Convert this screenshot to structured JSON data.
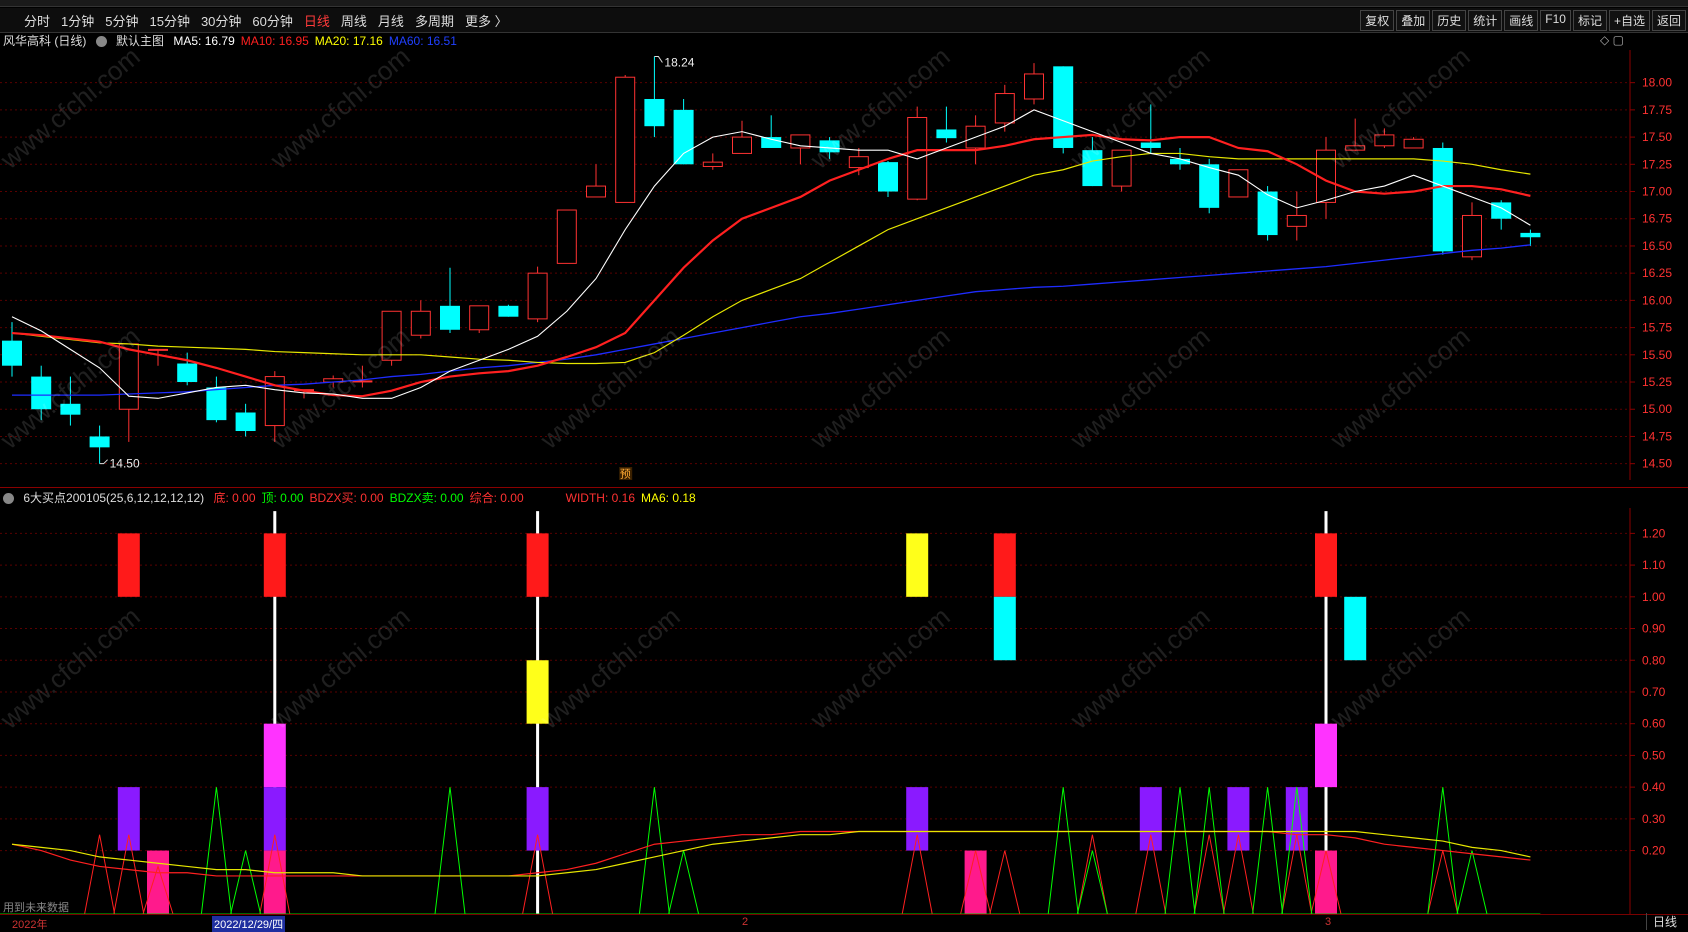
{
  "toolbar": {
    "periods": [
      "分时",
      "1分钟",
      "5分钟",
      "15分钟",
      "30分钟",
      "60分钟",
      "日线",
      "周线",
      "月线",
      "多周期",
      "更多 〉"
    ],
    "active_period": "日线",
    "right_buttons": [
      "复权",
      "叠加",
      "历史",
      "统计",
      "画线",
      "F10",
      "标记",
      "+自选",
      "返回"
    ]
  },
  "main_legend": {
    "stock": "风华高科 (日线)",
    "template": "默认主图",
    "items": [
      {
        "label": "MA5: 16.79",
        "color": "#ffffff"
      },
      {
        "label": "MA10: 16.95",
        "color": "#ff2020"
      },
      {
        "label": "MA20: 17.16",
        "color": "#ffff00"
      },
      {
        "label": "MA60: 16.51",
        "color": "#2040ff"
      }
    ]
  },
  "main_chart": {
    "type": "candlestick",
    "y_ticks": [
      "18.00",
      "17.75",
      "17.50",
      "17.25",
      "17.00",
      "16.75",
      "16.50",
      "16.25",
      "16.00",
      "15.75",
      "15.50",
      "15.25",
      "15.00",
      "14.75",
      "14.50"
    ],
    "ylim": [
      14.35,
      18.3
    ],
    "high_label": "18.24",
    "low_label": "14.50",
    "marker": "预",
    "colors": {
      "up": "#ff3232",
      "down": "#00ffff",
      "ma5": "#ffffff",
      "ma10": "#ff2020",
      "ma20": "#e6e600",
      "ma60": "#1e2cff"
    },
    "candles": [
      [
        15.63,
        15.4,
        15.8,
        15.3
      ],
      [
        15.3,
        15.0,
        15.4,
        14.9
      ],
      [
        15.05,
        14.95,
        15.3,
        14.85
      ],
      [
        14.75,
        14.65,
        14.85,
        14.5
      ],
      [
        15.0,
        15.6,
        15.6,
        14.7
      ],
      [
        15.55,
        15.55,
        15.55,
        15.4
      ],
      [
        15.42,
        15.25,
        15.52,
        15.22
      ],
      [
        15.2,
        14.9,
        15.3,
        14.88
      ],
      [
        14.97,
        14.8,
        15.05,
        14.75
      ],
      [
        14.85,
        15.3,
        15.35,
        14.7
      ],
      [
        15.18,
        15.18,
        15.18,
        15.1
      ],
      [
        15.25,
        15.28,
        15.31,
        15.2
      ],
      [
        15.26,
        15.26,
        15.4,
        15.2
      ],
      [
        15.45,
        15.9,
        15.9,
        15.4
      ],
      [
        15.68,
        15.9,
        16.0,
        15.65
      ],
      [
        15.95,
        15.73,
        16.3,
        15.7
      ],
      [
        15.73,
        15.95,
        15.95,
        15.7
      ],
      [
        15.95,
        15.85,
        15.96,
        15.85
      ],
      [
        15.83,
        16.25,
        16.31,
        15.8
      ],
      [
        16.34,
        16.83,
        16.83,
        16.34
      ],
      [
        16.95,
        17.05,
        17.25,
        16.95
      ],
      [
        16.9,
        18.05,
        18.07,
        16.9
      ],
      [
        17.85,
        17.6,
        18.24,
        17.5
      ],
      [
        17.75,
        17.25,
        17.85,
        17.25
      ],
      [
        17.23,
        17.27,
        17.35,
        17.2
      ],
      [
        17.35,
        17.5,
        17.65,
        17.35
      ],
      [
        17.5,
        17.4,
        17.7,
        17.4
      ],
      [
        17.4,
        17.52,
        17.52,
        17.25
      ],
      [
        17.47,
        17.36,
        17.5,
        17.3
      ],
      [
        17.22,
        17.32,
        17.4,
        17.15
      ],
      [
        17.27,
        17.0,
        17.28,
        16.95
      ],
      [
        16.93,
        17.68,
        17.78,
        16.92
      ],
      [
        17.57,
        17.49,
        17.78,
        17.45
      ],
      [
        17.4,
        17.6,
        17.7,
        17.25
      ],
      [
        17.63,
        17.9,
        17.98,
        17.55
      ],
      [
        17.85,
        18.08,
        18.18,
        17.8
      ],
      [
        18.15,
        17.4,
        18.15,
        17.35
      ],
      [
        17.38,
        17.05,
        17.5,
        17.05
      ],
      [
        17.05,
        17.38,
        17.38,
        17.0
      ],
      [
        17.45,
        17.4,
        17.8,
        17.35
      ],
      [
        17.3,
        17.25,
        17.4,
        17.2
      ],
      [
        17.25,
        16.85,
        17.3,
        16.8
      ],
      [
        16.95,
        17.2,
        17.2,
        16.95
      ],
      [
        17.0,
        16.6,
        17.05,
        16.55
      ],
      [
        16.68,
        16.78,
        17.0,
        16.55
      ],
      [
        16.9,
        17.38,
        17.5,
        16.75
      ],
      [
        17.38,
        17.42,
        17.67,
        17.37
      ],
      [
        17.42,
        17.52,
        17.58,
        17.4
      ],
      [
        17.4,
        17.48,
        17.5,
        17.4
      ],
      [
        17.4,
        16.45,
        17.45,
        16.42
      ],
      [
        16.4,
        16.78,
        16.9,
        16.37
      ],
      [
        16.9,
        16.75,
        16.92,
        16.65
      ],
      [
        16.62,
        16.58,
        16.65,
        16.5
      ]
    ],
    "ma5": [
      15.85,
      15.72,
      15.55,
      15.38,
      15.12,
      15.1,
      15.15,
      15.2,
      15.22,
      15.18,
      15.15,
      15.14,
      15.1,
      15.1,
      15.2,
      15.35,
      15.45,
      15.55,
      15.67,
      15.9,
      16.2,
      16.65,
      17.05,
      17.35,
      17.5,
      17.55,
      17.48,
      17.42,
      17.4,
      17.38,
      17.38,
      17.3,
      17.4,
      17.5,
      17.6,
      17.75,
      17.65,
      17.55,
      17.45,
      17.35,
      17.3,
      17.22,
      17.15,
      16.97,
      16.85,
      16.92,
      17.0,
      17.05,
      17.15,
      17.05,
      16.95,
      16.85,
      16.69
    ],
    "ma10": [
      15.7,
      15.68,
      15.65,
      15.62,
      15.55,
      15.5,
      15.45,
      15.38,
      15.3,
      15.22,
      15.17,
      15.13,
      15.12,
      15.17,
      15.25,
      15.3,
      15.33,
      15.35,
      15.4,
      15.48,
      15.57,
      15.7,
      16.0,
      16.3,
      16.55,
      16.75,
      16.85,
      16.95,
      17.1,
      17.2,
      17.3,
      17.38,
      17.38,
      17.38,
      17.42,
      17.48,
      17.5,
      17.52,
      17.48,
      17.47,
      17.5,
      17.5,
      17.4,
      17.37,
      17.25,
      17.1,
      17.0,
      16.98,
      17.0,
      17.05,
      17.05,
      17.02,
      16.96
    ],
    "ma20": [
      15.7,
      15.67,
      15.64,
      15.61,
      15.6,
      15.58,
      15.57,
      15.56,
      15.55,
      15.53,
      15.52,
      15.51,
      15.5,
      15.5,
      15.5,
      15.48,
      15.46,
      15.45,
      15.43,
      15.42,
      15.42,
      15.43,
      15.52,
      15.68,
      15.85,
      16.0,
      16.1,
      16.2,
      16.35,
      16.5,
      16.65,
      16.75,
      16.85,
      16.95,
      17.05,
      17.15,
      17.2,
      17.28,
      17.32,
      17.35,
      17.35,
      17.32,
      17.3,
      17.3,
      17.3,
      17.3,
      17.3,
      17.3,
      17.3,
      17.28,
      17.25,
      17.2,
      17.16
    ],
    "ma60": [
      15.13,
      15.13,
      15.13,
      15.13,
      15.14,
      15.15,
      15.16,
      15.18,
      15.2,
      15.22,
      15.23,
      15.25,
      15.27,
      15.3,
      15.32,
      15.35,
      15.38,
      15.4,
      15.43,
      15.46,
      15.5,
      15.55,
      15.6,
      15.65,
      15.7,
      15.75,
      15.8,
      15.85,
      15.88,
      15.92,
      15.96,
      16.0,
      16.04,
      16.08,
      16.1,
      16.12,
      16.13,
      16.15,
      16.17,
      16.19,
      16.21,
      16.23,
      16.25,
      16.27,
      16.29,
      16.31,
      16.34,
      16.37,
      16.4,
      16.43,
      16.46,
      16.48,
      16.51
    ]
  },
  "sub_legend": {
    "name": "6大买点200105(25,6,12,12,12,12)",
    "items": [
      {
        "label": "底: 0.00",
        "color": "#ff3232"
      },
      {
        "label": "顶: 0.00",
        "color": "#00ff00"
      },
      {
        "label": "BDZX买: 0.00",
        "color": "#ff3232"
      },
      {
        "label": "BDZX卖: 0.00",
        "color": "#00ff00"
      },
      {
        "label": "综合: 0.00",
        "color": "#ff3232"
      },
      {
        "label": "WIDTH: 0.16",
        "color": "#ff3232"
      },
      {
        "label": "MA6: 0.18",
        "color": "#ffff00"
      }
    ]
  },
  "sub_chart": {
    "y_ticks": [
      "1.20",
      "1.10",
      "1.00",
      "0.90",
      "0.80",
      "0.70",
      "0.60",
      "0.50",
      "0.40",
      "0.30",
      "0.20"
    ],
    "ylim": [
      0.0,
      1.28
    ],
    "bars": [
      {
        "i": 4,
        "bottom": 1.0,
        "top": 1.2,
        "color": "#ff1a1a"
      },
      {
        "i": 4,
        "bottom": 0.2,
        "top": 0.4,
        "color": "#8a1aff"
      },
      {
        "i": 5,
        "bottom": 0.0,
        "top": 0.2,
        "color": "#ff1a8c"
      },
      {
        "i": 9,
        "bottom": 1.0,
        "top": 1.2,
        "color": "#ff1a1a"
      },
      {
        "i": 9,
        "bottom": 0.4,
        "top": 0.6,
        "color": "#ff33ff"
      },
      {
        "i": 9,
        "bottom": 0.2,
        "top": 0.4,
        "color": "#8a1aff"
      },
      {
        "i": 9,
        "bottom": 0.0,
        "top": 0.2,
        "color": "#ff1a8c"
      },
      {
        "i": 18,
        "bottom": 1.0,
        "top": 1.2,
        "color": "#ff1a1a"
      },
      {
        "i": 18,
        "bottom": 0.6,
        "top": 0.8,
        "color": "#ffff1a"
      },
      {
        "i": 18,
        "bottom": 0.2,
        "top": 0.4,
        "color": "#8a1aff"
      },
      {
        "i": 31,
        "bottom": 1.0,
        "top": 1.2,
        "color": "#ffff1a"
      },
      {
        "i": 31,
        "bottom": 0.2,
        "top": 0.4,
        "color": "#8a1aff"
      },
      {
        "i": 33,
        "bottom": 0.0,
        "top": 0.2,
        "color": "#ff1a8c"
      },
      {
        "i": 34,
        "bottom": 1.0,
        "top": 1.2,
        "color": "#ff1a1a"
      },
      {
        "i": 34,
        "bottom": 0.8,
        "top": 1.0,
        "color": "#00ffff"
      },
      {
        "i": 39,
        "bottom": 0.2,
        "top": 0.4,
        "color": "#8a1aff"
      },
      {
        "i": 42,
        "bottom": 0.2,
        "top": 0.4,
        "color": "#8a1aff"
      },
      {
        "i": 44,
        "bottom": 0.2,
        "top": 0.4,
        "color": "#8a1aff"
      },
      {
        "i": 45,
        "bottom": 1.0,
        "top": 1.2,
        "color": "#ff1a1a"
      },
      {
        "i": 45,
        "bottom": 0.4,
        "top": 0.6,
        "color": "#ff33ff"
      },
      {
        "i": 45,
        "bottom": 0.0,
        "top": 0.2,
        "color": "#ff1a8c"
      },
      {
        "i": 46,
        "bottom": 0.8,
        "top": 1.0,
        "color": "#00ffff"
      }
    ],
    "white_lines": [
      9,
      18,
      45
    ],
    "red_spikes": [
      [
        3,
        0.25
      ],
      [
        4,
        0.25
      ],
      [
        5,
        0.15
      ],
      [
        9,
        0.25
      ],
      [
        18,
        0.25
      ],
      [
        31,
        0.25
      ],
      [
        33,
        0.2
      ],
      [
        34,
        0.2
      ],
      [
        37,
        0.25
      ],
      [
        39,
        0.25
      ],
      [
        41,
        0.25
      ],
      [
        42,
        0.25
      ],
      [
        44,
        0.25
      ],
      [
        45,
        0.2
      ],
      [
        49,
        0.2
      ]
    ],
    "green_spikes": [
      [
        7,
        0.4
      ],
      [
        8,
        0.2
      ],
      [
        15,
        0.4
      ],
      [
        22,
        0.4
      ],
      [
        23,
        0.2
      ],
      [
        36,
        0.4
      ],
      [
        37,
        0.2
      ],
      [
        40,
        0.4
      ],
      [
        41,
        0.4
      ],
      [
        43,
        0.4
      ],
      [
        44,
        0.4
      ],
      [
        49,
        0.4
      ],
      [
        50,
        0.2
      ]
    ],
    "width_line": [
      0.22,
      0.2,
      0.17,
      0.15,
      0.14,
      0.13,
      0.13,
      0.12,
      0.12,
      0.12,
      0.12,
      0.12,
      0.12,
      0.12,
      0.12,
      0.12,
      0.12,
      0.12,
      0.13,
      0.14,
      0.16,
      0.19,
      0.22,
      0.23,
      0.24,
      0.25,
      0.25,
      0.26,
      0.26,
      0.26,
      0.26,
      0.26,
      0.26,
      0.26,
      0.26,
      0.26,
      0.26,
      0.26,
      0.26,
      0.26,
      0.26,
      0.26,
      0.26,
      0.26,
      0.25,
      0.25,
      0.24,
      0.22,
      0.21,
      0.2,
      0.19,
      0.18,
      0.17
    ],
    "ma6_line": [
      0.22,
      0.21,
      0.2,
      0.18,
      0.17,
      0.16,
      0.15,
      0.14,
      0.14,
      0.13,
      0.13,
      0.13,
      0.12,
      0.12,
      0.12,
      0.12,
      0.12,
      0.12,
      0.12,
      0.13,
      0.14,
      0.16,
      0.18,
      0.2,
      0.22,
      0.23,
      0.24,
      0.25,
      0.25,
      0.26,
      0.26,
      0.26,
      0.26,
      0.26,
      0.26,
      0.26,
      0.26,
      0.26,
      0.26,
      0.26,
      0.26,
      0.26,
      0.26,
      0.26,
      0.26,
      0.26,
      0.26,
      0.25,
      0.24,
      0.23,
      0.21,
      0.2,
      0.18
    ]
  },
  "footer": {
    "note": "用到未来数据",
    "year": "2022年",
    "date_cursor": "2022/12/29/四",
    "month_2": "2",
    "month_3": "3",
    "period": "日线"
  },
  "watermark": "www.cfchi.com"
}
